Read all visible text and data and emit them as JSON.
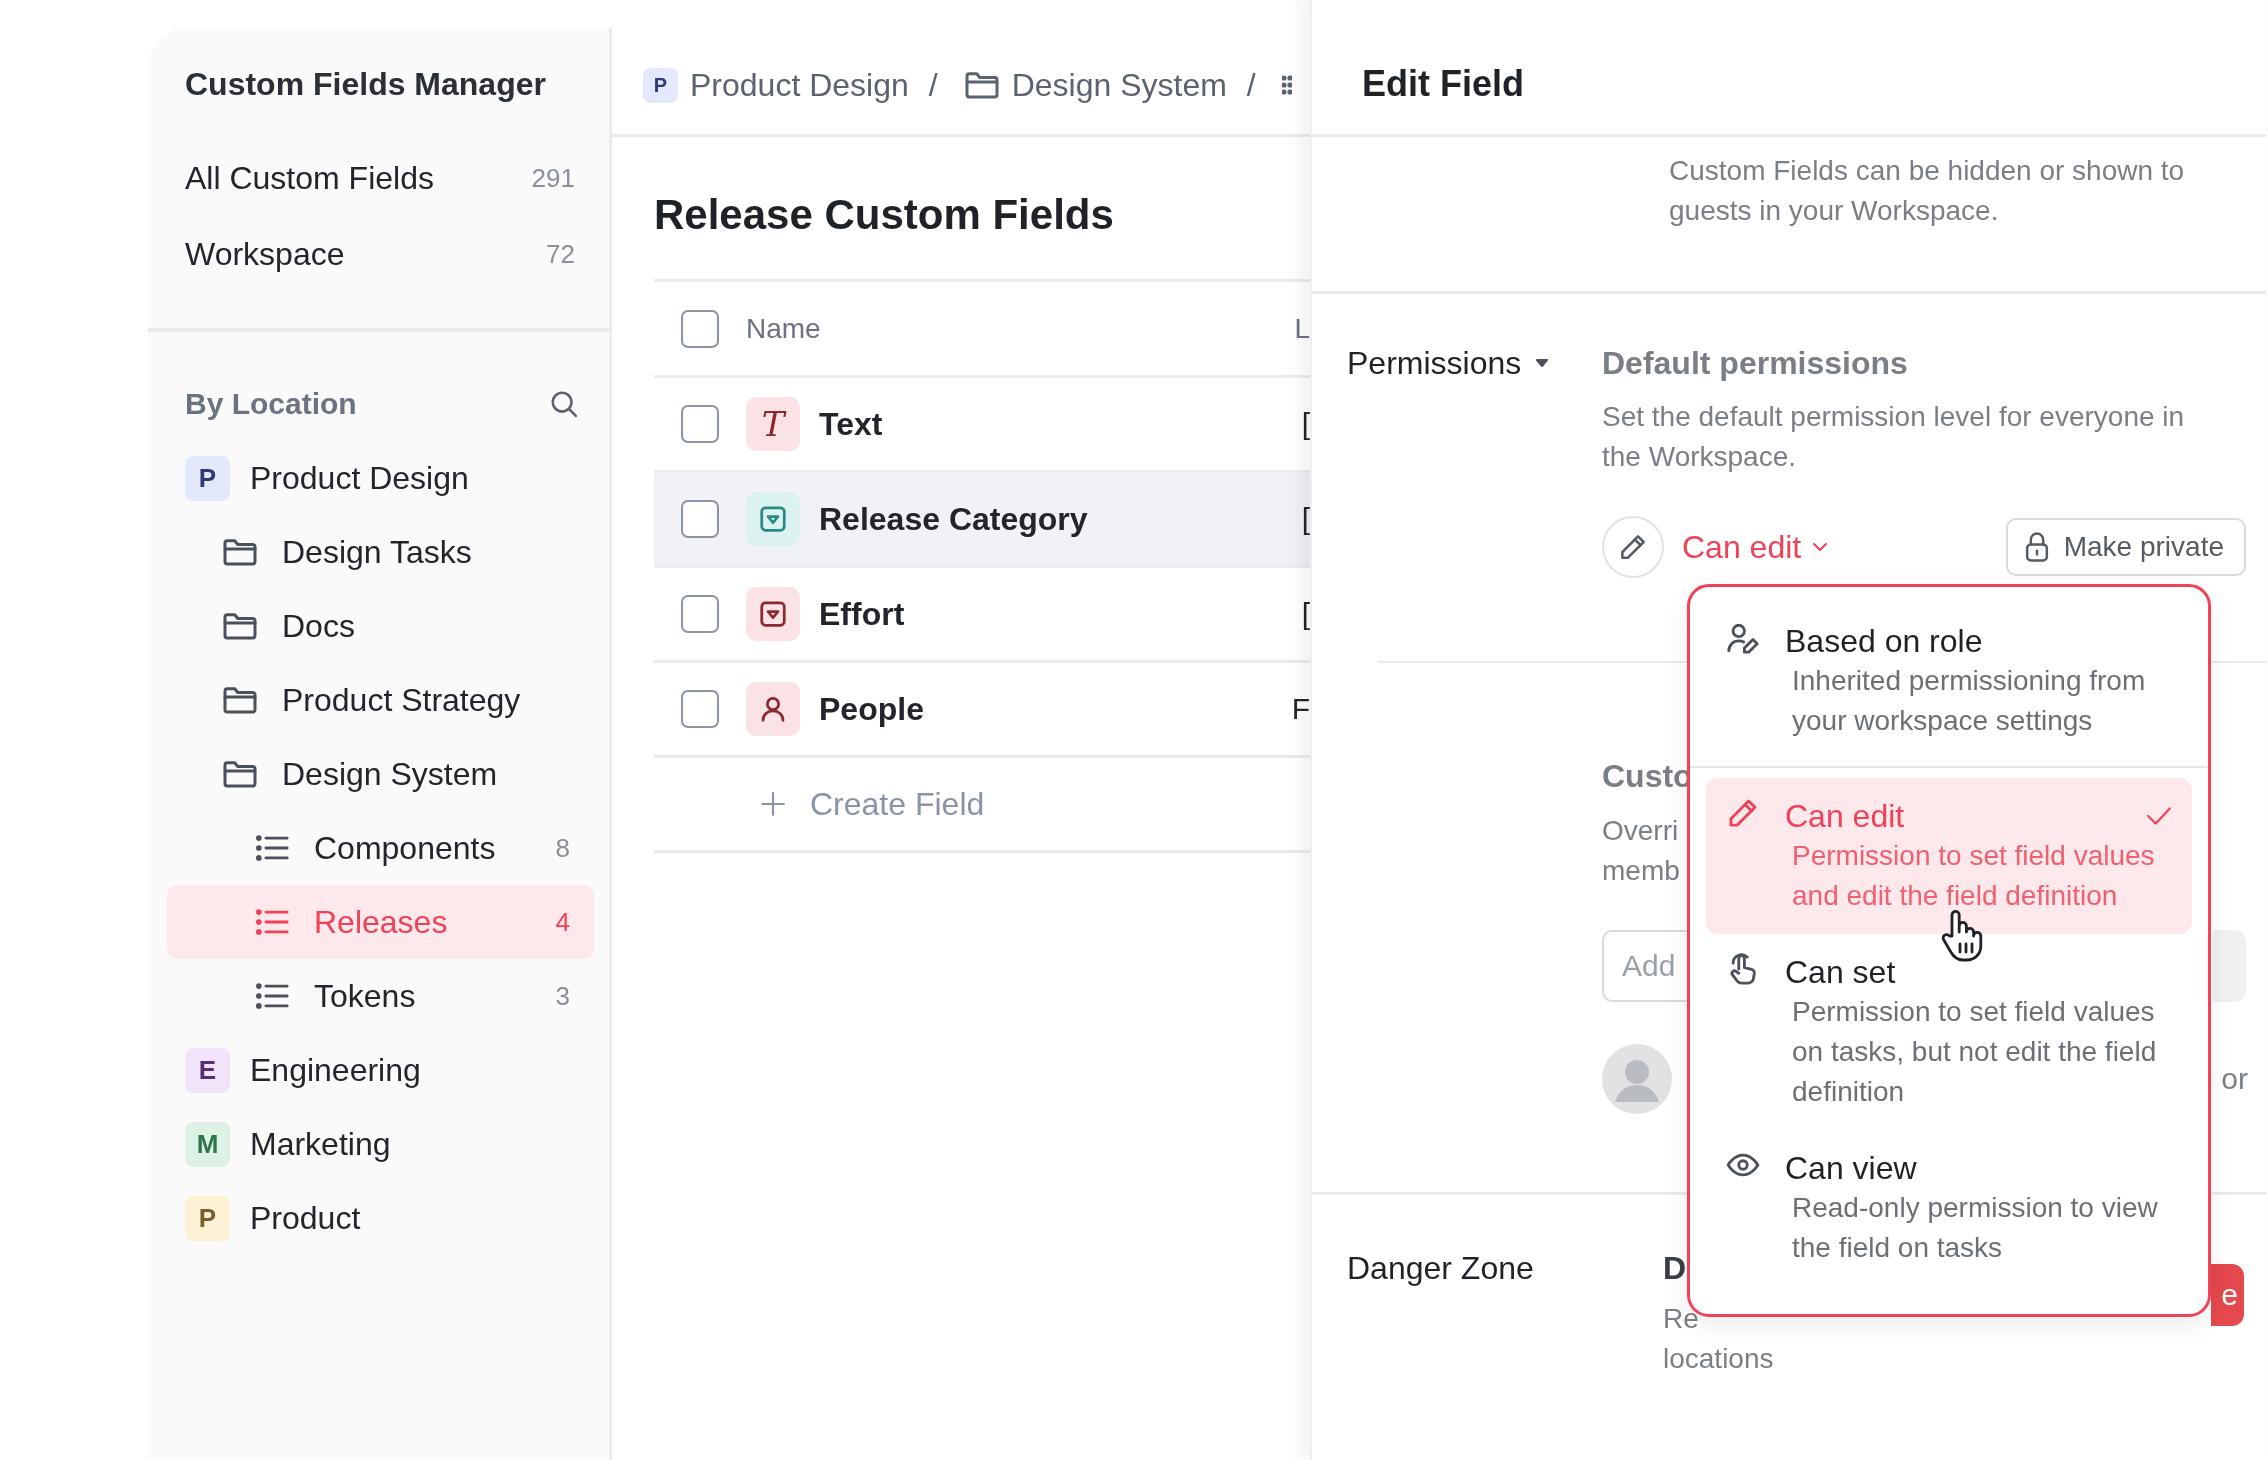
{
  "sidebar": {
    "title": "Custom Fields Manager",
    "summary": [
      {
        "label": "All Custom Fields",
        "count": "291"
      },
      {
        "label": "Workspace",
        "count": "72"
      }
    ],
    "section_title": "By Location",
    "tree": [
      {
        "kind": "space",
        "badge": "P",
        "color": "#e3e8fc",
        "label": "Product Design",
        "selected": false,
        "children": [
          {
            "kind": "folder",
            "label": "Design Tasks",
            "selected": false
          },
          {
            "kind": "folder",
            "label": "Docs",
            "selected": false
          },
          {
            "kind": "folder",
            "label": "Product Strategy",
            "selected": false
          },
          {
            "kind": "folder",
            "label": "Design System",
            "selected": false,
            "children": [
              {
                "kind": "list",
                "label": "Components",
                "count": "8",
                "selected": false
              },
              {
                "kind": "list",
                "label": "Releases",
                "count": "4",
                "selected": true
              },
              {
                "kind": "list",
                "label": "Tokens",
                "count": "3",
                "selected": false
              }
            ]
          }
        ]
      },
      {
        "kind": "space",
        "badge": "E",
        "color": "#f1e4fa",
        "label": "Engineering",
        "selected": false
      },
      {
        "kind": "space",
        "badge": "M",
        "color": "#ddf1e4",
        "label": "Marketing",
        "selected": false
      },
      {
        "kind": "space",
        "badge": "P",
        "color": "#fdf1d6",
        "label": "Product",
        "selected": false
      }
    ]
  },
  "breadcrumb": [
    {
      "kind": "space",
      "badge": "P",
      "color": "#e3e8fc",
      "label": "Product Design",
      "separator": "/"
    },
    {
      "kind": "folder",
      "label": "Design System",
      "separator": "/"
    },
    {
      "kind": "list"
    }
  ],
  "fields": {
    "title": "Release Custom Fields",
    "columns": [
      "Name",
      "L"
    ],
    "header_checked": false,
    "rows": [
      {
        "kind": "text",
        "glyph": "T",
        "color": "#fbe3e5",
        "name": "Text",
        "column_2": "[",
        "checked": false,
        "hovered": false
      },
      {
        "kind": "dropdown",
        "color": "#dcf2f0",
        "name": "Release Category",
        "column_2": "[",
        "checked": false,
        "hovered": true
      },
      {
        "kind": "dropdown",
        "color": "#fbe3e5",
        "name": "Effort",
        "column_2": "[",
        "checked": false,
        "hovered": false
      },
      {
        "kind": "people",
        "color": "#fbe3e5",
        "name": "People",
        "column_2": "F",
        "checked": false,
        "hovered": false
      }
    ],
    "create_label": "Create Field"
  },
  "edit_panel": {
    "title": "Edit Field",
    "visibility_note": "Custom Fields can be hidden or shown to guests in your Workspace.",
    "permissions": {
      "label": "Permissions",
      "heading": "Default permissions",
      "description": "Set the default permission level for everyone in the Workspace.",
      "current": "Can edit",
      "private_button": "Make private",
      "custom_heading": "Custo",
      "custom_lines": [
        "Overri",
        "memb"
      ],
      "input_placeholder": "Add",
      "member_text": "or"
    },
    "menu": {
      "options": [
        {
          "kind": "role",
          "label": "Based on role",
          "description": "Inherited permissioning from your workspace settings",
          "selected": false
        },
        {
          "kind": "edit",
          "label": "Can edit",
          "description": "Permission to set field values and edit the field definition",
          "selected": true
        },
        {
          "kind": "set",
          "label": "Can set",
          "description": "Permission to set field values on tasks, but not edit the field definition",
          "selected": false
        },
        {
          "kind": "view",
          "label": "Can view",
          "description": "Read-only permission to view the field on tasks",
          "selected": false
        }
      ]
    },
    "danger_zone": {
      "label": "Danger Zone",
      "heading": "D",
      "lines": [
        "Re",
        "locations"
      ],
      "button": "e"
    }
  }
}
